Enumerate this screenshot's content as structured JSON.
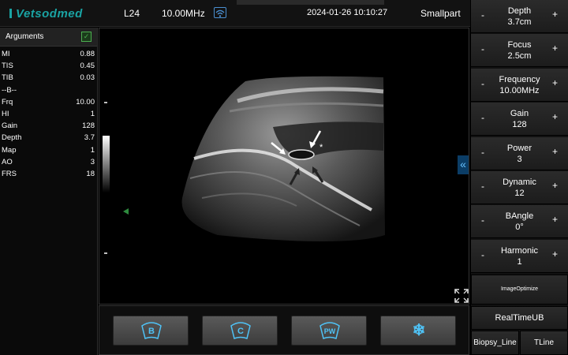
{
  "header": {
    "logo": "Vetsodmed",
    "probe": "L24",
    "frequency": "10.00MHz",
    "datetime": "2024-01-26 10:10:27",
    "preset": "Smallpart"
  },
  "arguments": {
    "title": "Arguments",
    "rows": [
      {
        "key": "MI",
        "value": "0.88"
      },
      {
        "key": "TIS",
        "value": "0.45"
      },
      {
        "key": "TIB",
        "value": "0.03"
      },
      {
        "key": "--B--",
        "value": ""
      },
      {
        "key": "Frq",
        "value": "10.00"
      },
      {
        "key": "HI",
        "value": "1"
      },
      {
        "key": "Gain",
        "value": "128"
      },
      {
        "key": "Depth",
        "value": "3.7"
      },
      {
        "key": "Map",
        "value": "1"
      },
      {
        "key": "AO",
        "value": "3"
      },
      {
        "key": "FRS",
        "value": "18"
      }
    ]
  },
  "image": {
    "annotation_star": "*"
  },
  "modes": [
    {
      "label": "B"
    },
    {
      "label": "C"
    },
    {
      "label": "PW"
    },
    {
      "label": "❄"
    }
  ],
  "controls": [
    {
      "name": "Depth",
      "value": "3.7cm"
    },
    {
      "name": "Focus",
      "value": "2.5cm"
    },
    {
      "name": "Frequency",
      "value": "10.00MHz"
    },
    {
      "name": "Gain",
      "value": "128"
    },
    {
      "name": "Power",
      "value": "3"
    },
    {
      "name": "Dynamic",
      "value": "12"
    },
    {
      "name": "BAngle",
      "value": "0°"
    },
    {
      "name": "Harmonic",
      "value": "1"
    }
  ],
  "buttons": {
    "image_optimize": "ImageOptimize",
    "realtime": "RealTimeUB",
    "biopsy": "Biopsy_Line",
    "tline": "TLine"
  },
  "colors": {
    "accent": "#4fc3f7",
    "logo": "#1aa3a3",
    "focus_marker": "#2e8b3e"
  }
}
